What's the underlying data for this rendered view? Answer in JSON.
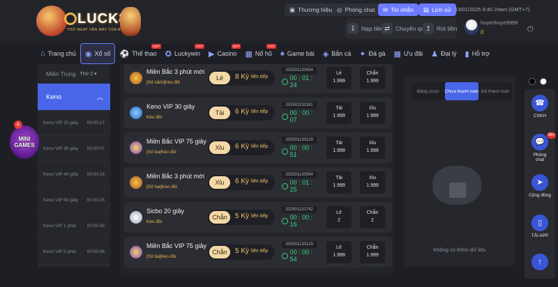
{
  "header": {
    "logo_text": "LUCK8",
    "logo_tagline": "THỬ NGAY VẬN MAY CỦA BẠN",
    "pills": [
      {
        "icon": "brand-icon",
        "label": "Thương hiệu"
      },
      {
        "icon": "chat-icon",
        "label": "Phòng chat"
      },
      {
        "icon": "message-icon",
        "label": "Tin nhắn",
        "active": true
      },
      {
        "icon": "history-icon",
        "label": "Lịch sử",
        "active": true
      }
    ],
    "datetime": "13/01/2025 9:40 24am  (GMT+7)",
    "tools": [
      {
        "icon": "deposit-icon",
        "label": "Nạp tiền"
      },
      {
        "icon": "transfer-icon",
        "label": "Chuyển quỹ"
      },
      {
        "icon": "withdraw-icon",
        "label": "Rút tiền"
      }
    ],
    "username": "huyenhuye9999",
    "balance": "0"
  },
  "nav": [
    {
      "icon": "home-icon",
      "label": "Trang chủ"
    },
    {
      "icon": "lottery-icon",
      "label": "Xổ số",
      "active": true
    },
    {
      "icon": "sports-icon",
      "label": "Thể thao",
      "hot": "HOT"
    },
    {
      "icon": "luckywin-icon",
      "label": "Luckywin",
      "hot": "HOT"
    },
    {
      "icon": "casino-icon",
      "label": "Casino",
      "hot": "HOT"
    },
    {
      "icon": "slot-icon",
      "label": "Nổ hũ",
      "hot": "HOT"
    },
    {
      "icon": "cardgame-icon",
      "label": "Game bài"
    },
    {
      "icon": "fish-icon",
      "label": "Bắn cá"
    },
    {
      "icon": "cockfight-icon",
      "label": "Đá gà"
    },
    {
      "icon": "promo-icon",
      "label": "Ưu đãi"
    },
    {
      "icon": "agent-icon",
      "label": "Đại lý"
    },
    {
      "icon": "support-icon",
      "label": "Hỗ trợ"
    }
  ],
  "sidebar": {
    "region_label": "Miền Trung",
    "region_select": "Thứ 2",
    "section": "Keno",
    "items": [
      {
        "name": "Keno VIP 20 giây",
        "time": "00:00:17"
      },
      {
        "name": "Keno VIP 30 giây",
        "time": "00:00:07"
      },
      {
        "name": "Keno VIP 40 giây",
        "time": "00:00:16"
      },
      {
        "name": "Keno VIP 50 giây",
        "time": "00:00:26"
      },
      {
        "name": "Keno VIP 1 phút",
        "time": "00:00:36"
      },
      {
        "name": "Keno VIP 5 phút",
        "time": "00:00:36"
      }
    ]
  },
  "mini_games": {
    "label1": "MINI",
    "label2": "GAMES",
    "badge": "6"
  },
  "rows": [
    {
      "name": "Miền Bắc 3 phút mới",
      "sub": "[Số năm]Kèo đôi",
      "choice": "Lẻ",
      "ky": "8 Kỳ",
      "lt": "liên tiếp",
      "period": "202501130054",
      "timer": "00 : 01 : 24",
      "odds": [
        [
          "Lẻ",
          "1.999"
        ],
        [
          "Chẵn",
          "1.999"
        ]
      ]
    },
    {
      "name": "Keno VIP 30 giây",
      "sub": "Kèo đôi",
      "choice": "Tài",
      "ky": "6 Kỳ",
      "lt": "liên tiếp",
      "period": "202501131161",
      "timer": "00 : 00 : 07",
      "odds": [
        [
          "Tài",
          "1.999"
        ],
        [
          "Xỉu",
          "1.999"
        ]
      ]
    },
    {
      "name": "Miền Bắc VIP 75 giây",
      "sub": "[Số ba]Kèo đôi",
      "choice": "Xỉu",
      "ky": "6 Kỳ",
      "lt": "liên tiếp",
      "period": "202501130129",
      "timer": "00 : 00 : 51",
      "odds": [
        [
          "Tài",
          "1.999"
        ],
        [
          "Xỉu",
          "1.999"
        ]
      ]
    },
    {
      "name": "Miền Bắc 3 phút mới",
      "sub": "[Số hai]Kèo đôi",
      "choice": "Xỉu",
      "ky": "6 Kỳ",
      "lt": "liên tiếp",
      "period": "202501130054",
      "timer": "00 : 01 : 25",
      "odds": [
        [
          "Tài",
          "1.999"
        ],
        [
          "Xỉu",
          "1.999"
        ]
      ]
    },
    {
      "name": "Sicbo 20 giây",
      "sub": "Kèo đôi",
      "choice": "Chẵn",
      "ky": "5 Kỳ",
      "lt": "liên tiếp",
      "period": "202501131742",
      "timer": "00 : 00 : 16",
      "odds": [
        [
          "Lẻ",
          "2"
        ],
        [
          "Chẵn",
          "2"
        ]
      ]
    },
    {
      "name": "Miền Bắc VIP 75 giây",
      "sub": "[Số ba]Kèo đôi",
      "choice": "Chẵn",
      "ky": "5 Kỳ",
      "lt": "liên tiếp",
      "period": "202501130129",
      "timer": "00 : 00 : 54",
      "odds": [
        [
          "Lẻ",
          "1.999"
        ],
        [
          "Chẵn",
          "1.999"
        ]
      ]
    }
  ],
  "bet_panel": {
    "tabs": [
      {
        "label": "Bảng cược"
      },
      {
        "label": "Chưa thanh toán",
        "active": true
      },
      {
        "label": "Đã thanh toán"
      }
    ],
    "empty_text": "Không có thêm dữ liệu"
  },
  "dock": [
    {
      "icon": "headset-icon",
      "label": "CSKH"
    },
    {
      "icon": "chat-bubble-icon",
      "label": "Phòng chat",
      "badge": "99+"
    },
    {
      "icon": "send-icon",
      "label": "Cộng đồng"
    },
    {
      "icon": "app-icon",
      "label": "TẢI APP"
    },
    {
      "icon": "arrow-up-icon",
      "label": ""
    }
  ],
  "colors": {
    "accent": "#4a66e8",
    "gold": "#f1b84a",
    "timer_green": "#3fd27c",
    "bg": "#1e1f24"
  }
}
